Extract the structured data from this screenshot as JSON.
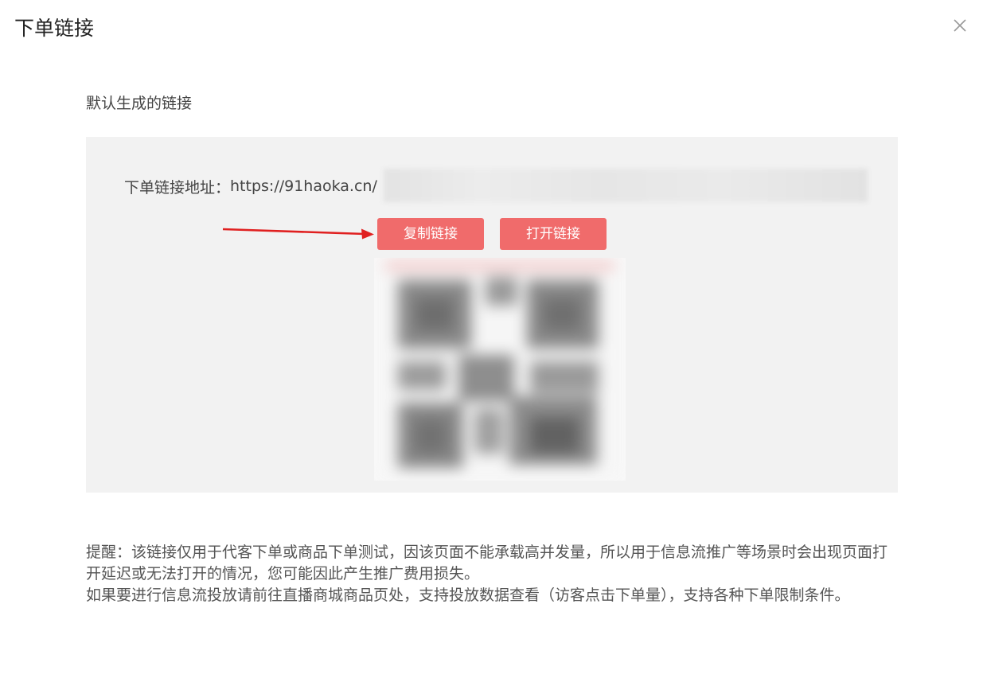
{
  "dialog": {
    "title": "下单链接",
    "close_icon": "close-icon"
  },
  "section": {
    "label": "默认生成的链接"
  },
  "link": {
    "label": "下单链接地址：",
    "url": "https://91haoka.cn/"
  },
  "buttons": {
    "copy_label": "复制链接",
    "open_label": "打开链接",
    "color": "#f06b6b"
  },
  "qr": {
    "icon": "qr-code-icon"
  },
  "notice": {
    "paragraph1": "提醒：该链接仅用于代客下单或商品下单测试，因该页面不能承载高并发量，所以用于信息流推广等场景时会出现页面打开延迟或无法打开的情况，您可能因此产生推广费用损失。",
    "paragraph2": "如果要进行信息流投放请前往直播商城商品页处，支持投放数据查看（访客点击下单量），支持各种下单限制条件。"
  }
}
